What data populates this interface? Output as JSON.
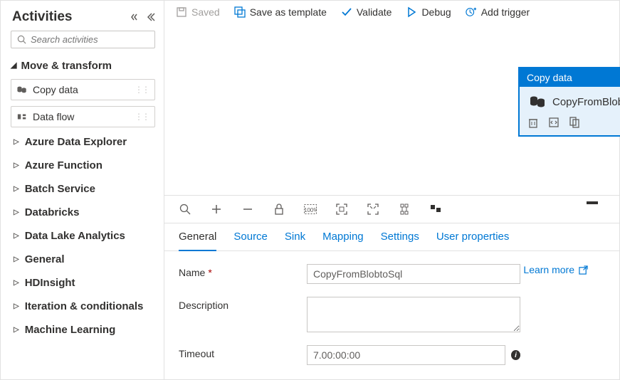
{
  "sidebar": {
    "title": "Activities",
    "search_placeholder": "Search activities",
    "expanded_group": "Move & transform",
    "cards": [
      {
        "label": "Copy data"
      },
      {
        "label": "Data flow"
      }
    ],
    "categories": [
      "Azure Data Explorer",
      "Azure Function",
      "Batch Service",
      "Databricks",
      "Data Lake Analytics",
      "General",
      "HDInsight",
      "Iteration & conditionals",
      "Machine Learning"
    ]
  },
  "toolbar": {
    "saved": "Saved",
    "save_as_template": "Save as template",
    "validate": "Validate",
    "debug": "Debug",
    "add_trigger": "Add trigger"
  },
  "node": {
    "header": "Copy data",
    "name": "CopyFromBlobtoSql"
  },
  "tabs": {
    "general": "General",
    "source": "Source",
    "sink": "Sink",
    "mapping": "Mapping",
    "settings": "Settings",
    "user_properties": "User properties"
  },
  "form": {
    "name_label": "Name",
    "name_value": "CopyFromBlobtoSql",
    "description_label": "Description",
    "description_value": "",
    "timeout_label": "Timeout",
    "timeout_value": "7.00:00:00",
    "learn_more": "Learn more"
  }
}
